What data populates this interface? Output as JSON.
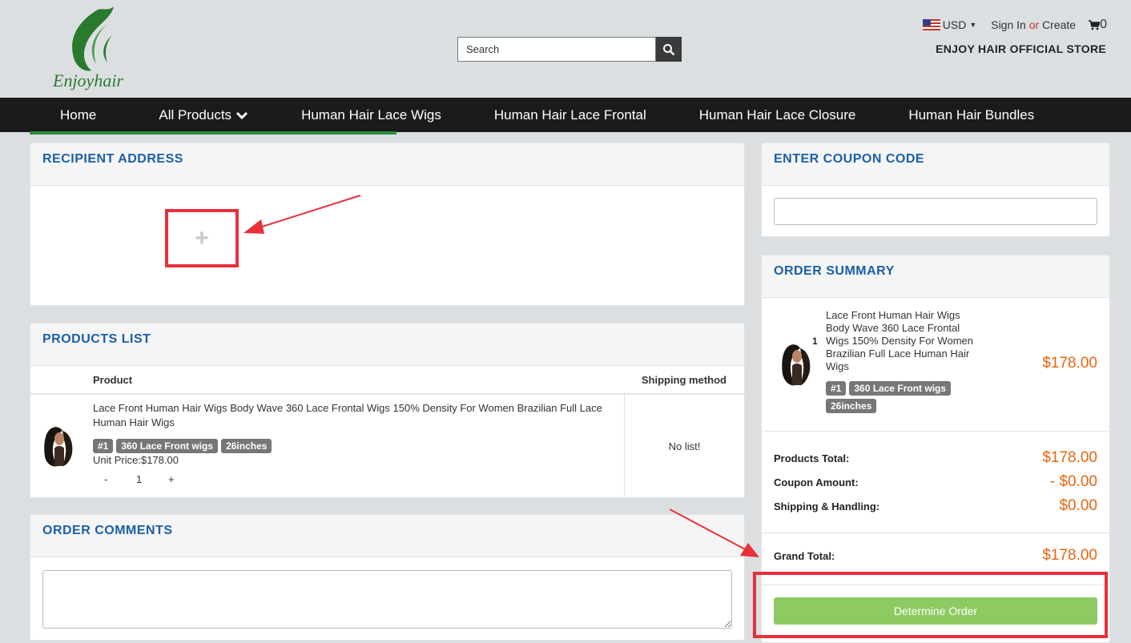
{
  "header": {
    "logo_text": "Enjoyhair",
    "search_placeholder": "Search",
    "currency": "USD",
    "sign_in": "Sign In",
    "or": "or",
    "create": "Create",
    "cart_count": "0",
    "store_name": "ENJOY HAIR OFFICIAL STORE"
  },
  "nav": {
    "items": [
      "Home",
      "All Products",
      "Human Hair Lace Wigs",
      "Human Hair Lace Frontal",
      "Human Hair Lace Closure",
      "Human Hair Bundles"
    ]
  },
  "recipient": {
    "title": "RECIPIENT ADDRESS",
    "add_symbol": "+"
  },
  "products": {
    "title": "PRODUCTS LIST",
    "col_product": "Product",
    "col_shipping": "Shipping method",
    "item": {
      "name": "Lace Front Human Hair Wigs Body Wave 360 Lace Frontal Wigs 150% Density For Women Brazilian Full Lace Human Hair Wigs",
      "tags": [
        "#1",
        "360 Lace Front wigs",
        "26inches"
      ],
      "unit_price": "Unit Price:$178.00",
      "qty_minus": "-",
      "qty": "1",
      "qty_plus": "+",
      "shipping": "No list!"
    }
  },
  "comments": {
    "title": "ORDER COMMENTS"
  },
  "coupon": {
    "title": "ENTER COUPON CODE"
  },
  "summary": {
    "title": "ORDER SUMMARY",
    "item": {
      "qty": "1",
      "name": "Lace Front Human Hair Wigs Body Wave 360 Lace Frontal Wigs 150% Density For Women Brazilian Full Lace Human Hair Wigs",
      "tags": [
        "#1",
        "360 Lace Front wigs",
        "26inches"
      ],
      "price": "$178.00"
    },
    "products_total_label": "Products Total:",
    "products_total": "$178.00",
    "coupon_label": "Coupon Amount:",
    "coupon_amount": "- $0.00",
    "shipping_label": "Shipping & Handling:",
    "shipping": "$0.00",
    "grand_label": "Grand Total:",
    "grand_total": "$178.00",
    "button": "Determine Order"
  },
  "colors": {
    "accent_blue": "#1a5fa8",
    "price_orange": "#e8650d",
    "button_green": "#8dcb62",
    "annotation_red": "#e8303a"
  }
}
